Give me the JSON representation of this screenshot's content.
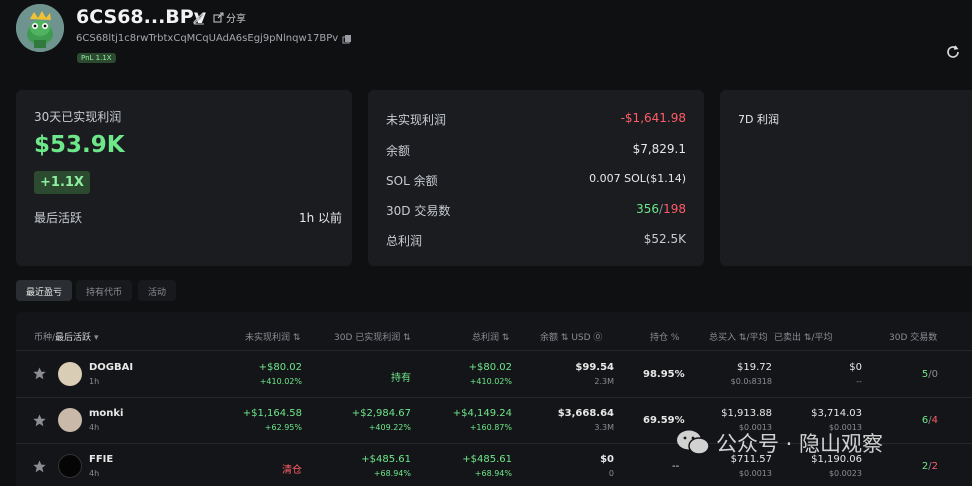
{
  "header": {
    "wallet_name": "6CS68...BPv",
    "share_label": "分享",
    "address": "6CS68ltj1c8rwTrbtxCqMCqUAdA6sEgj9pNlnqw17BPv",
    "pnl_badge": "PnL 1.1X"
  },
  "card_realized": {
    "title": "30天已实现利润",
    "value": "$53.9K",
    "multiplier": "+1.1X",
    "last_active_label": "最后活跃",
    "last_active_value": "1h 以前"
  },
  "card_stats": {
    "unrealized_label": "未实现利润",
    "unrealized_value": "-$1,641.98",
    "balance_label": "余额",
    "balance_value": "$7,829.1",
    "sol_label": "SOL 余额",
    "sol_value": "0.007 SOL($1.14)",
    "trades_label": "30D 交易数",
    "trades_buy": "356",
    "trades_sep": "/",
    "trades_sell": "198",
    "total_label": "总利润",
    "total_value": "$52.5K"
  },
  "card_7d": {
    "title": "7D 利润"
  },
  "tabs": [
    "最近盈亏",
    "持有代币",
    "活动"
  ],
  "table": {
    "headers": {
      "token": "币种/",
      "token_sort": "最后活跃",
      "unrealized": "未实现利润",
      "realized": "30D 已实现利润",
      "total": "总利润",
      "balance": "余额",
      "usd": "USD",
      "hold": "持仓 %",
      "bought": "总买入",
      "bought_avg": "/平均",
      "sold": "已卖出",
      "sold_avg": "/平均",
      "trades": "30D 交易数"
    },
    "rows": [
      {
        "name": "DOGBAI",
        "time": "1h",
        "unrealized": "+$80.02",
        "unrealized_pct": "+410.02%",
        "realized": "持有",
        "realized_pct": "",
        "total": "+$80.02",
        "total_pct": "+410.02%",
        "balance": "$99.54",
        "balance_sub": "2.3M",
        "hold": "98.95%",
        "bought": "$19.72",
        "bought_avg": "$0.0₅8318",
        "sold": "$0",
        "sold_avg": "--",
        "trades_buy": "5",
        "trades_sell": "0"
      },
      {
        "name": "monki",
        "time": "4h",
        "unrealized": "+$1,164.58",
        "unrealized_pct": "+62.95%",
        "realized": "+$2,984.67",
        "realized_pct": "+409.22%",
        "total": "+$4,149.24",
        "total_pct": "+160.87%",
        "balance": "$3,668.64",
        "balance_sub": "3.3M",
        "hold": "69.59%",
        "bought": "$1,913.88",
        "bought_avg": "$0.0013",
        "sold": "$3,714.03",
        "sold_avg": "$0.0013",
        "trades_buy": "6",
        "trades_sell": "4"
      },
      {
        "name": "FFIE",
        "time": "4h",
        "unrealized": "清仓",
        "unrealized_pct": "",
        "realized": "+$485.61",
        "realized_pct": "+68.94%",
        "total": "+$485.61",
        "total_pct": "+68.94%",
        "balance": "$0",
        "balance_sub": "0",
        "hold": "--",
        "bought": "$711.57",
        "bought_avg": "$0.0013",
        "sold": "$1,190.06",
        "sold_avg": "$0.0023",
        "trades_buy": "2",
        "trades_sell": "2"
      }
    ]
  },
  "watermark": "公众号 · 隐山观察",
  "colors": {
    "positive": "#6ee78a",
    "negative": "#ff5c68",
    "card_bg": "#1a1c20",
    "page_bg": "#0f1012"
  }
}
